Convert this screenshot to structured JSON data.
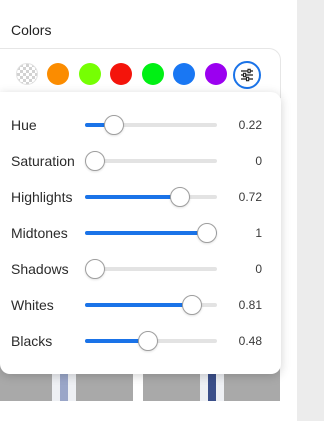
{
  "section_title": "Colors",
  "swatches": [
    {
      "name": "transparent",
      "color": "transparent"
    },
    {
      "name": "orange",
      "color": "#fb8c00"
    },
    {
      "name": "lime",
      "color": "#76ff03"
    },
    {
      "name": "red",
      "color": "#f4140b"
    },
    {
      "name": "green",
      "color": "#00f014"
    },
    {
      "name": "blue",
      "color": "#1977f3"
    },
    {
      "name": "purple",
      "color": "#9b00f0"
    }
  ],
  "settings_icon": "sliders-icon",
  "accent_color": "#1a73e8",
  "adjustments": [
    {
      "key": "hue",
      "label": "Hue",
      "value": "0.22",
      "fraction": 0.22
    },
    {
      "key": "saturation",
      "label": "Saturation",
      "value": "0",
      "fraction": 0
    },
    {
      "key": "highlights",
      "label": "Highlights",
      "value": "0.72",
      "fraction": 0.72
    },
    {
      "key": "midtones",
      "label": "Midtones",
      "value": "1",
      "fraction": 1
    },
    {
      "key": "shadows",
      "label": "Shadows",
      "value": "0",
      "fraction": 0
    },
    {
      "key": "whites",
      "label": "Whites",
      "value": "0.81",
      "fraction": 0.81
    },
    {
      "key": "blacks",
      "label": "Blacks",
      "value": "0.48",
      "fraction": 0.48
    }
  ]
}
